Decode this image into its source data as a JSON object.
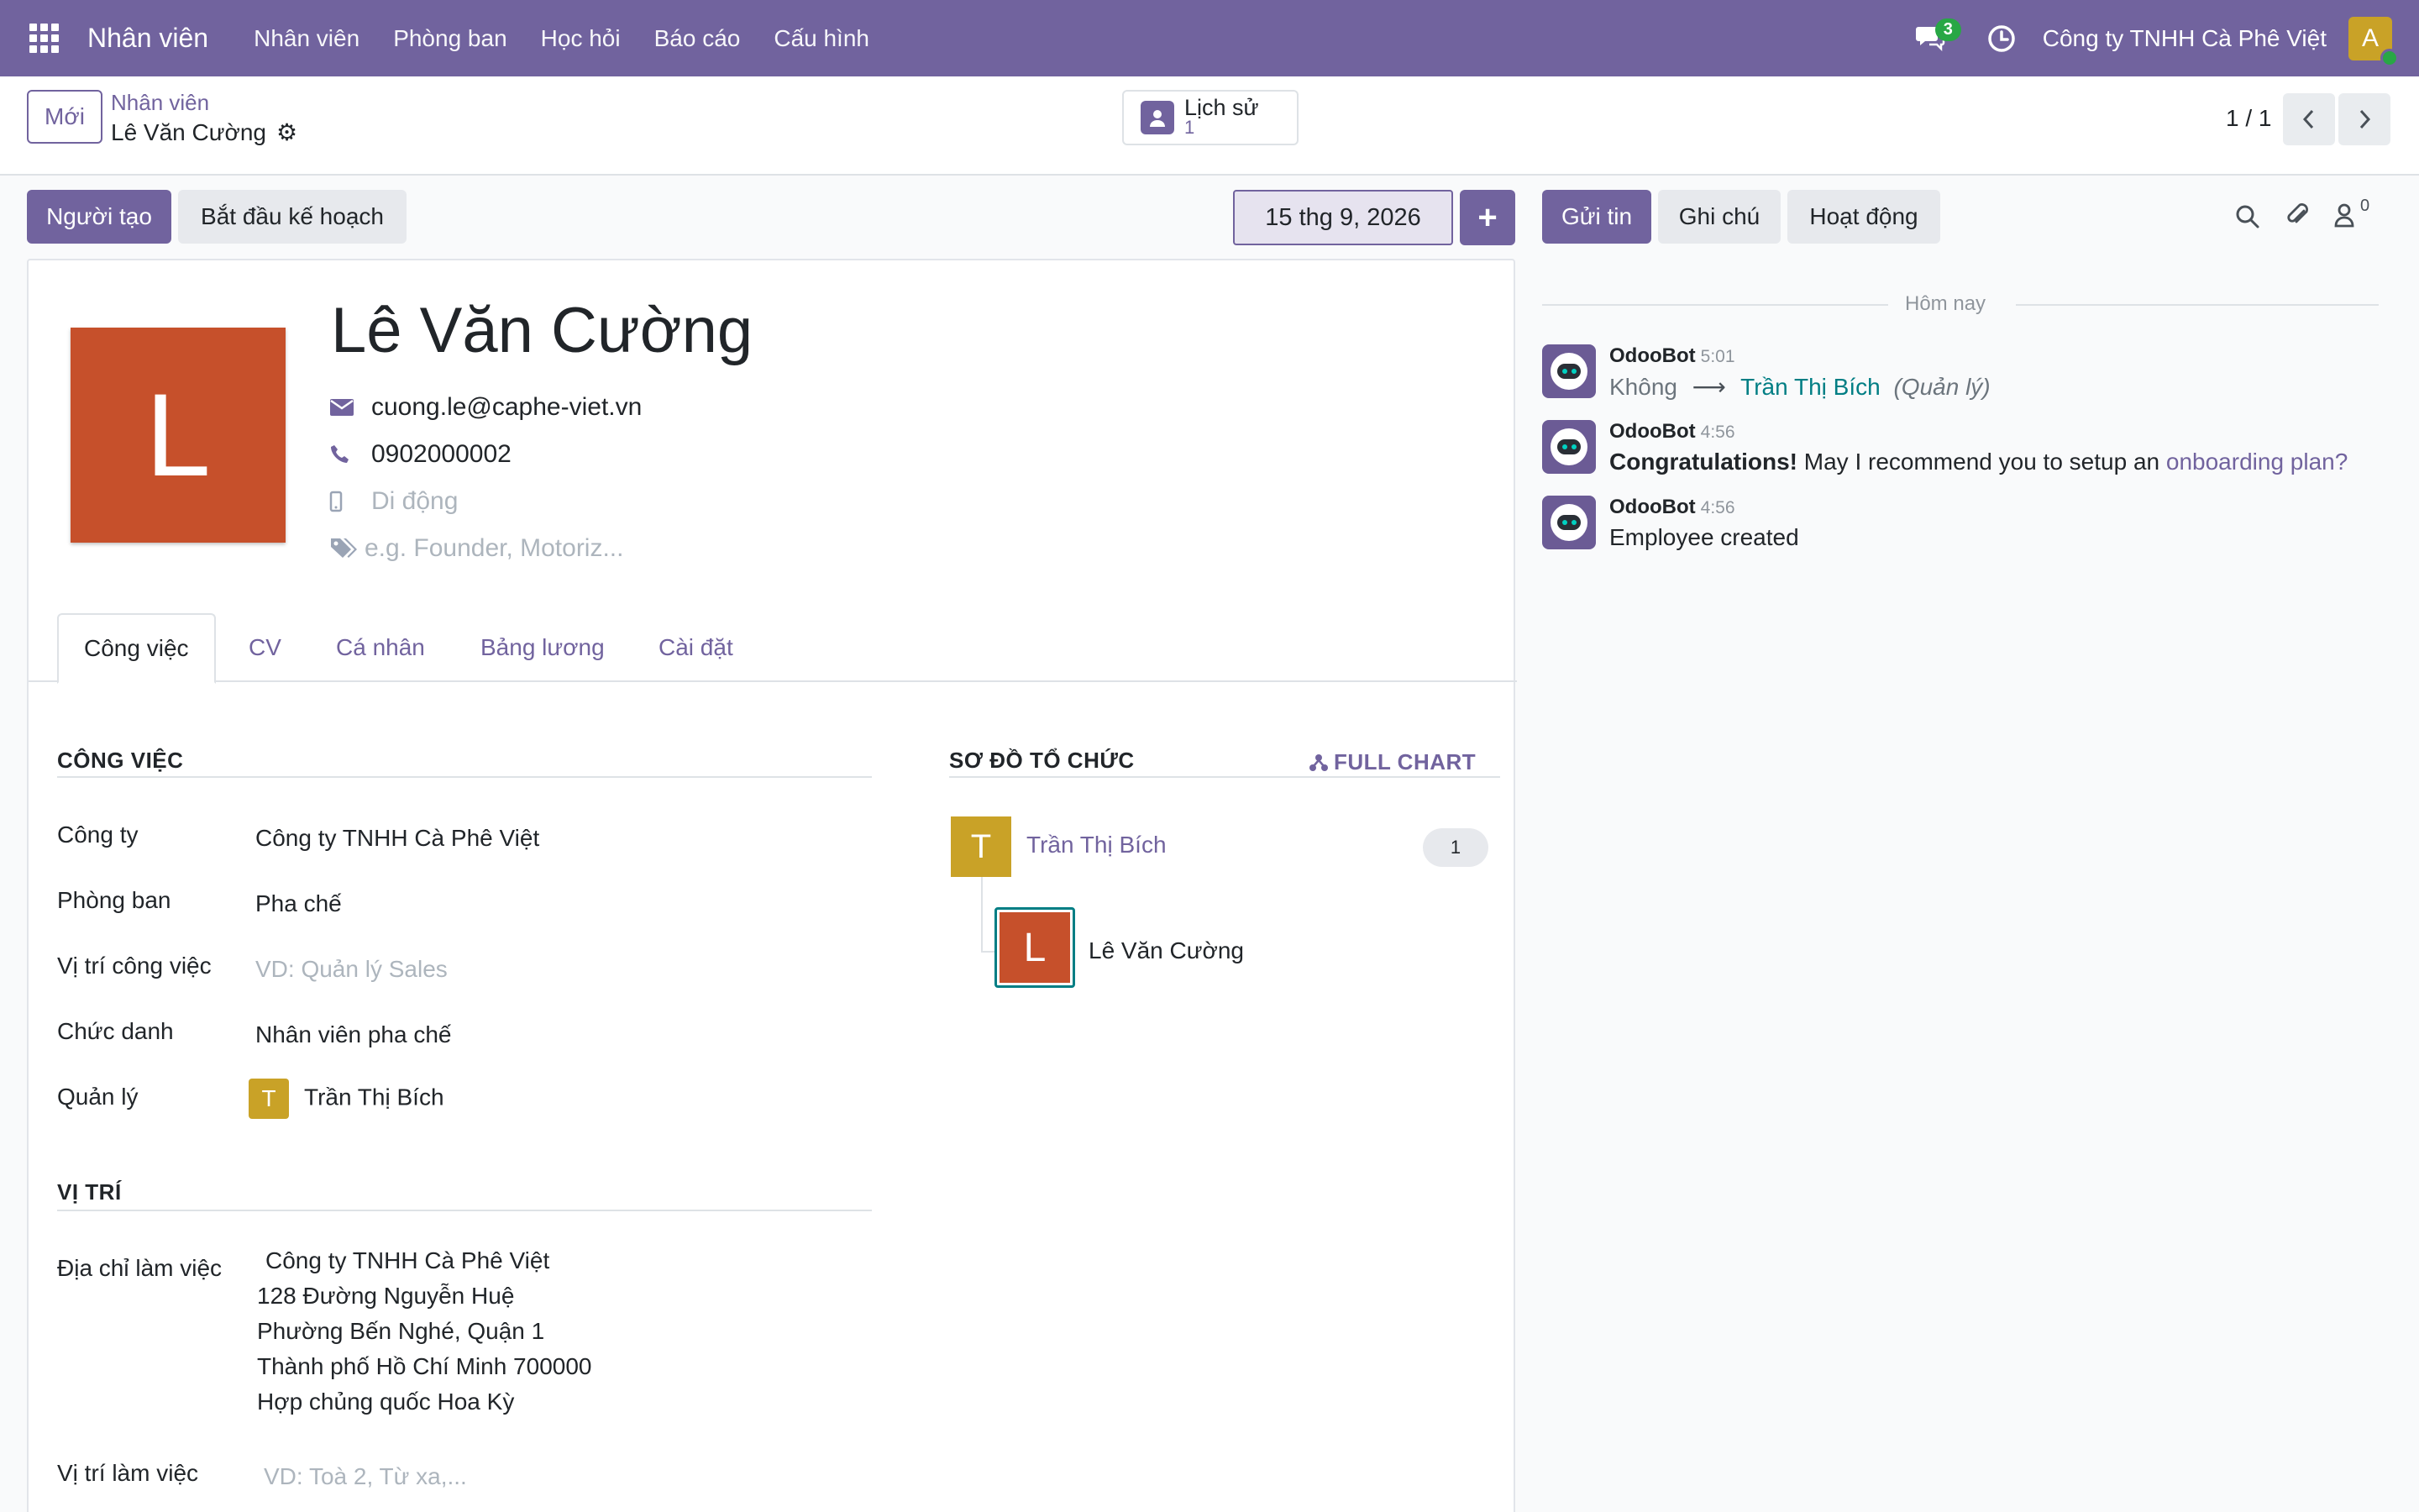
{
  "navbar": {
    "app_name": "Nhân viên",
    "menus": [
      "Nhân viên",
      "Phòng ban",
      "Học hỏi",
      "Báo cáo",
      "Cấu hình"
    ],
    "chat_count": "3",
    "company": "Công ty TNHH Cà Phê Việt",
    "user_initial": "A",
    "colors": {
      "brand": "#71639e",
      "online": "#28a745",
      "user_avatar": "#c9a227"
    }
  },
  "control": {
    "new_label": "Mới",
    "breadcrumb_parent": "Nhân viên",
    "breadcrumb_current": "Lê Văn Cường",
    "smart_button": {
      "label": "Lịch sử",
      "count": "1"
    },
    "pager": "1 / 1"
  },
  "statusbar": {
    "btn_creator": "Người tạo",
    "btn_start_plan": "Bắt đầu kế hoạch",
    "date": "15 thg 9, 2026",
    "plus": "+"
  },
  "employee": {
    "initial": "L",
    "name": "Lê Văn Cường",
    "email": "cuong.le@caphe-viet.vn",
    "phone": "0902000002",
    "mobile_placeholder": "Di động",
    "tags_placeholder": "e.g. Founder, Motoriz...",
    "avatar_color": "#c6502b"
  },
  "tabs": [
    "Công việc",
    "CV",
    "Cá nhân",
    "Bảng lương",
    "Cài đặt"
  ],
  "work": {
    "section_title": "CÔNG VIỆC",
    "fields": {
      "company_label": "Công ty",
      "company_value": "Công ty TNHH Cà Phê Việt",
      "department_label": "Phòng ban",
      "department_value": "Pha chế",
      "position_label": "Vị trí công việc",
      "position_placeholder": "VD: Quản lý Sales",
      "job_title_label": "Chức danh",
      "job_title_value": "Nhân viên pha chế",
      "manager_label": "Quản lý",
      "manager_initial": "T",
      "manager_value": "Trần Thị Bích"
    }
  },
  "location": {
    "section_title": "VỊ TRÍ",
    "address_label": "Địa chỉ làm việc",
    "address_lines": [
      "Công ty TNHH Cà Phê Việt",
      "128 Đường Nguyễn Huệ",
      "Phường Bến Nghé, Quận 1",
      "Thành phố Hồ Chí Minh 700000",
      "Hợp chủng quốc Hoa Kỳ"
    ],
    "work_location_label": "Vị trí làm việc",
    "work_location_placeholder": "VD: Toà 2, Từ xa,..."
  },
  "org_chart": {
    "title": "SƠ ĐỒ TỔ CHỨC",
    "full_chart": "FULL CHART",
    "manager_initial": "T",
    "manager_name": "Trần Thị Bích",
    "manager_count": "1",
    "employee_initial": "L",
    "employee_name": "Lê Văn Cường"
  },
  "chatter": {
    "send_message": "Gửi tin",
    "log_note": "Ghi chú",
    "activities": "Hoạt động",
    "followers_count": "0",
    "today": "Hôm nay",
    "messages": [
      {
        "author": "OdooBot",
        "time": "5:01",
        "from": "Không",
        "to": "Trần Thị Bích",
        "field": "(Quản lý)"
      },
      {
        "author": "OdooBot",
        "time": "4:56",
        "bold": "Congratulations!",
        "text": " May I recommend you to setup an ",
        "link": "onboarding plan?"
      },
      {
        "author": "OdooBot",
        "time": "4:56",
        "text": "Employee created"
      }
    ]
  }
}
